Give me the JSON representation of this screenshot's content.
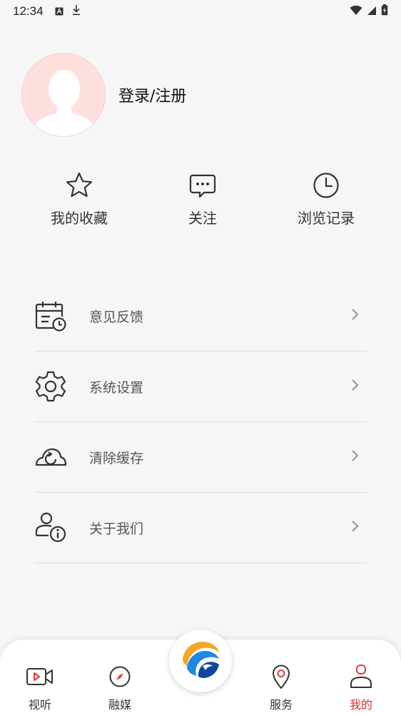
{
  "status_bar": {
    "time": "12:34",
    "icons_left": [
      "font-icon",
      "download-icon"
    ],
    "icons_right": [
      "wifi-icon",
      "signal-icon",
      "battery-charging-icon"
    ]
  },
  "profile": {
    "login_text": "登录/注册",
    "avatar_bg": "#fde0dd"
  },
  "quick_actions": [
    {
      "label": "我的收藏",
      "icon": "star-icon"
    },
    {
      "label": "关注",
      "icon": "chat-bubble-icon"
    },
    {
      "label": "浏览记录",
      "icon": "clock-icon"
    }
  ],
  "menu": [
    {
      "label": "意见反馈",
      "icon": "calendar-clock-icon"
    },
    {
      "label": "系统设置",
      "icon": "gear-icon"
    },
    {
      "label": "清除缓存",
      "icon": "cloud-refresh-icon"
    },
    {
      "label": "关于我们",
      "icon": "user-info-icon"
    }
  ],
  "tab_bar": {
    "tabs": [
      {
        "label": "视听",
        "icon": "video-icon",
        "active": false
      },
      {
        "label": "融媒",
        "icon": "compass-icon",
        "active": false
      },
      {
        "label": "服务",
        "icon": "location-pin-icon",
        "active": false
      },
      {
        "label": "我的",
        "icon": "user-icon",
        "active": true
      }
    ],
    "center_icon": "app-logo-icon",
    "active_color": "#d32f2f"
  }
}
